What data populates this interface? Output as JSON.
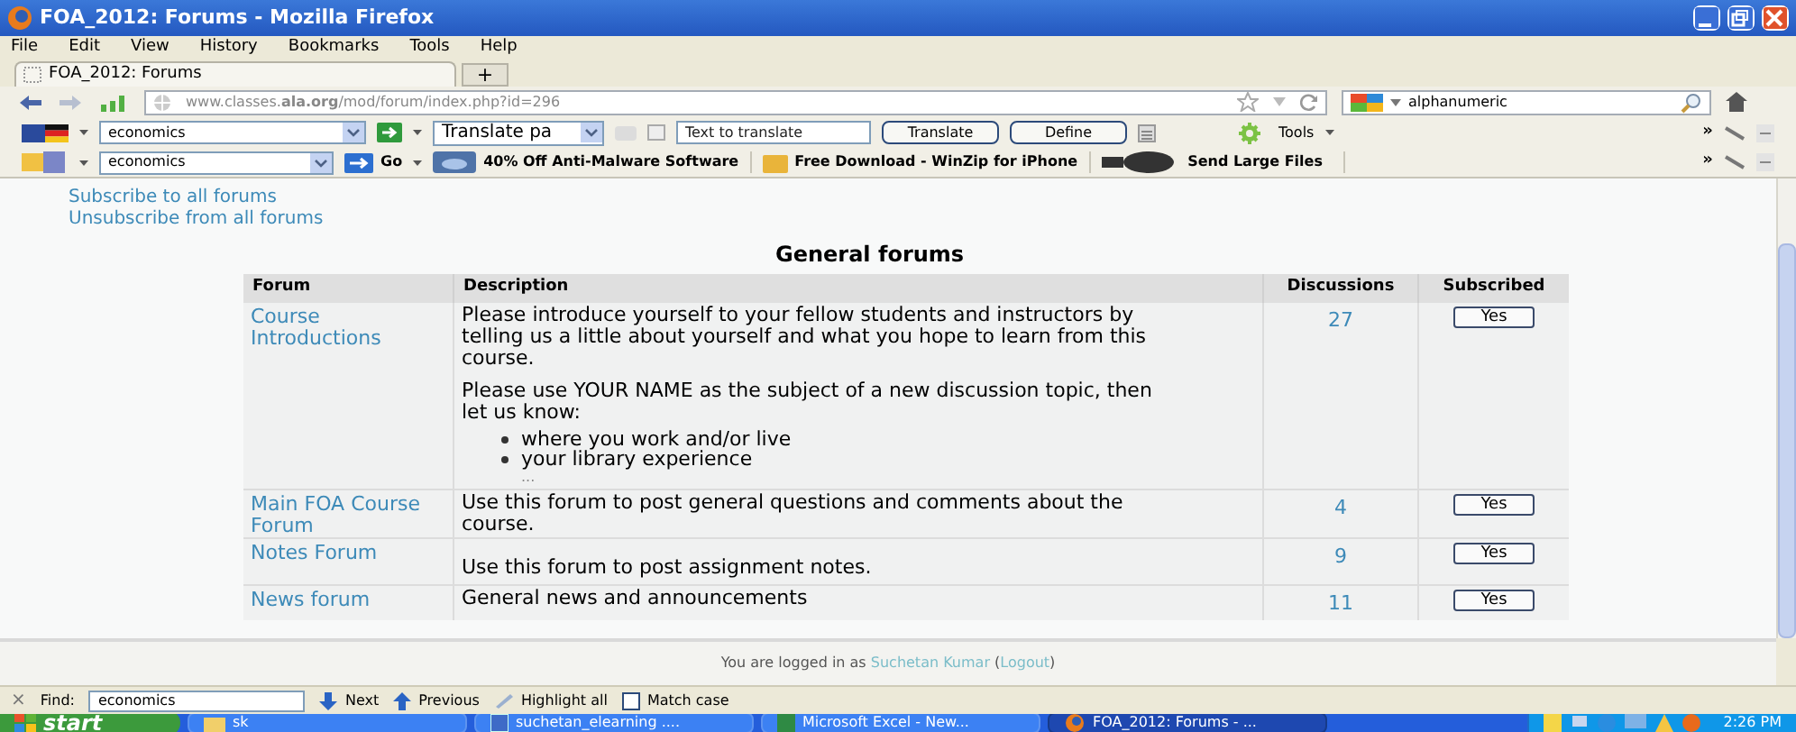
{
  "window": {
    "title": "FOA_2012: Forums - Mozilla Firefox"
  },
  "menu": [
    "File",
    "Edit",
    "View",
    "History",
    "Bookmarks",
    "Tools",
    "Help"
  ],
  "tab": {
    "title": "FOA_2012: Forums",
    "selected": true
  },
  "new_tab": "+",
  "address": {
    "url": "www.classes.**ala.org**/mod/forum/index.php?id=296"
  },
  "search": {
    "value": "alphanumeric"
  },
  "toolbar_1": {
    "dropdown": "economics",
    "translate_select": "Translate pa",
    "text_field_placeholder": "Text to translate",
    "buttons": [
      "Translate",
      "Define"
    ],
    "tools": "Tools",
    "more": "»"
  },
  "toolbar_2": {
    "dropdown": "economics",
    "go": "Go",
    "links": [
      "40% Off Anti-Malware Software",
      "Free Download - WinZip for iPhone",
      "Send Large Files"
    ],
    "more": "»"
  },
  "page": {
    "links": [
      "Subscribe to all forums",
      "Unsubscribe from all forums"
    ],
    "heading": "General forums",
    "columns": [
      "Forum",
      "Description",
      "Discussions",
      "Subscribed"
    ],
    "rows": [
      {
        "forum": "Course Introductions",
        "paragraphs": [
          "Please introduce yourself to your fellow students and instructors by telling us a little about yourself and what you hope to learn from this course.",
          "Please use YOUR NAME as the subject of a new discussion topic, then let us know:"
        ],
        "bullets": [
          "where you work and/or live",
          "your library experience"
        ],
        "ellipsis": "...",
        "discussions": "27",
        "subscribed": "Yes"
      },
      {
        "forum": "Main FOA Course Forum",
        "paragraphs": [
          "Use this forum to post general questions and comments about the course."
        ],
        "discussions": "4",
        "subscribed": "Yes"
      },
      {
        "forum": "Notes Forum",
        "paragraphs": [
          "Use this forum to post assignment notes."
        ],
        "discussions": "9",
        "subscribed": "Yes"
      },
      {
        "forum": "News forum",
        "paragraphs": [
          "General news and announcements"
        ],
        "discussions": "11",
        "subscribed": "Yes"
      }
    ],
    "login": {
      "prefix": "You are logged in as",
      "user": "Suchetan Kumar",
      "open": "(",
      "logout": "Logout",
      "close": ")"
    }
  },
  "find_bar": {
    "close": "×",
    "label": "Find:",
    "value": "economics",
    "next": "Next",
    "previous": "Previous",
    "highlight": "Highlight all",
    "match_case": {
      "label": "Match case",
      "checked": false
    }
  },
  "taskbar": {
    "start": "start",
    "items": [
      {
        "label": "sk",
        "selected": false
      },
      {
        "label": "suchetan_elearning ....",
        "selected": false
      },
      {
        "label": "Microsoft Excel - New...",
        "selected": false
      },
      {
        "label": "FOA_2012: Forums - ...",
        "selected": true
      }
    ],
    "clock": "2:26 PM"
  }
}
